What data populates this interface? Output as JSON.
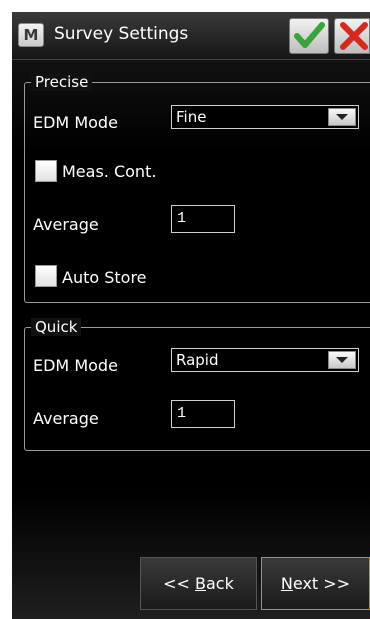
{
  "titlebar": {
    "app_icon_letter": "M",
    "title": "Survey Settings",
    "ok_color": "#3aa33a",
    "cancel_color": "#d42a1e"
  },
  "precise": {
    "legend": "Precise",
    "edm_label": "EDM Mode",
    "edm_value": "Fine",
    "meas_cont_label": "Meas. Cont.",
    "average_label": "Average",
    "average_value": "1",
    "auto_store_label": "Auto Store"
  },
  "quick": {
    "legend": "Quick",
    "edm_label": "EDM Mode",
    "edm_value": "Rapid",
    "average_label": "Average",
    "average_value": "1"
  },
  "nav": {
    "back_prefix": "<< ",
    "back_hotkey": "B",
    "back_rest": "ack",
    "next_hotkey": "N",
    "next_rest": "ext >>"
  }
}
